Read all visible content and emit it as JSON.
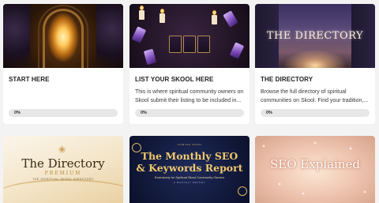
{
  "courses": [
    {
      "title": "START HERE",
      "description": "",
      "progress_label": "0%",
      "progress": 0
    },
    {
      "title": "LIST YOUR SKOOL HERE",
      "description": "This is where spiritual community owners on Skool submit their listing to be included in...",
      "progress_label": "0%",
      "progress": 0
    },
    {
      "title": "THE DIRECTORY",
      "description": "Browse the full directory of spiritual communities on Skool. Find your tradition,...",
      "progress_label": "0%",
      "progress": 0,
      "thumb_title": "THE DIRECTORY"
    },
    {
      "thumb_title": "The Directory",
      "thumb_subtitle": "PREMIUM",
      "thumb_tagline": "THE SPIRITUAL SKOOL DIRECTORY"
    },
    {
      "thumb_small": "COMING SOON",
      "thumb_title_line1": "The Monthly SEO",
      "thumb_title_line2": "& Keywords Report",
      "thumb_subtitle": "Exclusively for Spiritual Skool Community Owners",
      "thumb_line": "A MONTHLY REPORT"
    },
    {
      "thumb_title": "SEO Explained"
    }
  ],
  "colors": {
    "page_bg": "#f3f3f3",
    "card_bg": "#ffffff",
    "progress_track": "#e7e7e7",
    "gold": "#f0c86c"
  }
}
